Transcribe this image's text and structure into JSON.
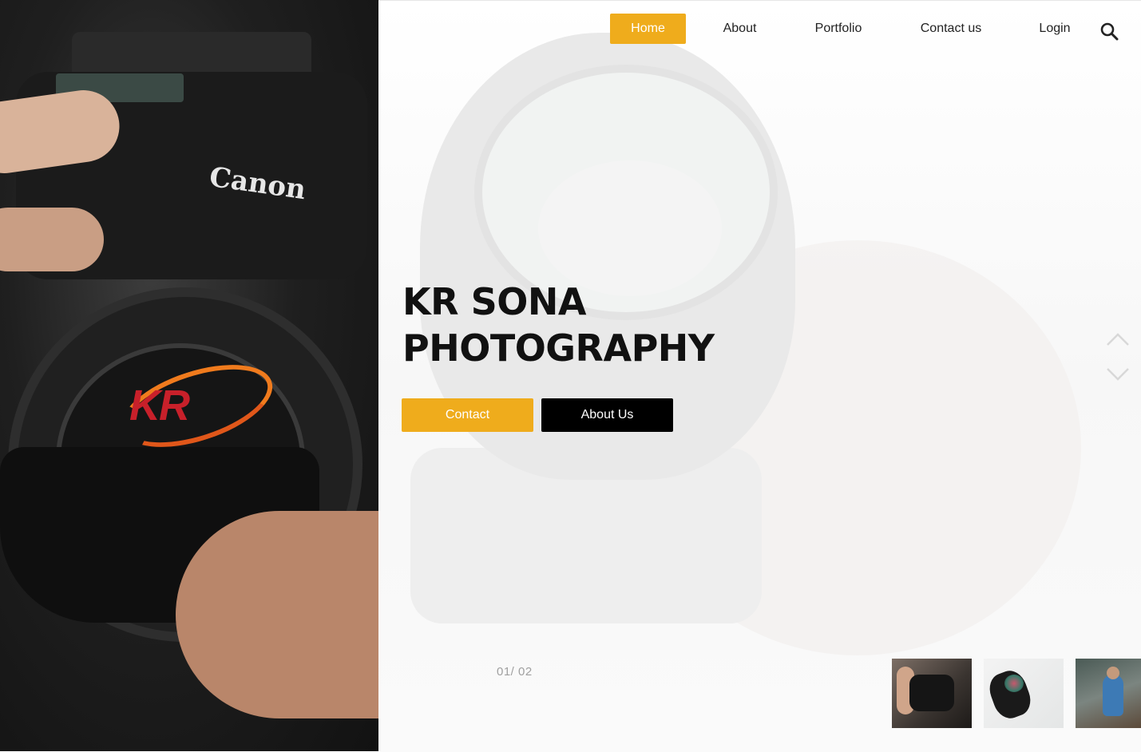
{
  "hero_photo": {
    "brand_text": "Canon",
    "logo_text": "KR"
  },
  "nav": {
    "items": [
      {
        "label": "Home",
        "active": true
      },
      {
        "label": "About",
        "active": false
      },
      {
        "label": "Portfolio",
        "active": false
      },
      {
        "label": "Contact us",
        "active": false
      },
      {
        "label": "Login",
        "active": false
      }
    ],
    "search_icon": "search-icon"
  },
  "hero": {
    "title_line1": "KR SONA",
    "title_line2": "PHOTOGRAPHY",
    "contact_label": "Contact",
    "about_label": "About Us"
  },
  "slider": {
    "counter": "01/ 02",
    "up_icon": "chevron-up-icon",
    "down_icon": "chevron-down-icon"
  },
  "colors": {
    "accent": "#efac1c",
    "dark": "#000000",
    "text": "#222222",
    "muted": "#a0a0a0"
  }
}
